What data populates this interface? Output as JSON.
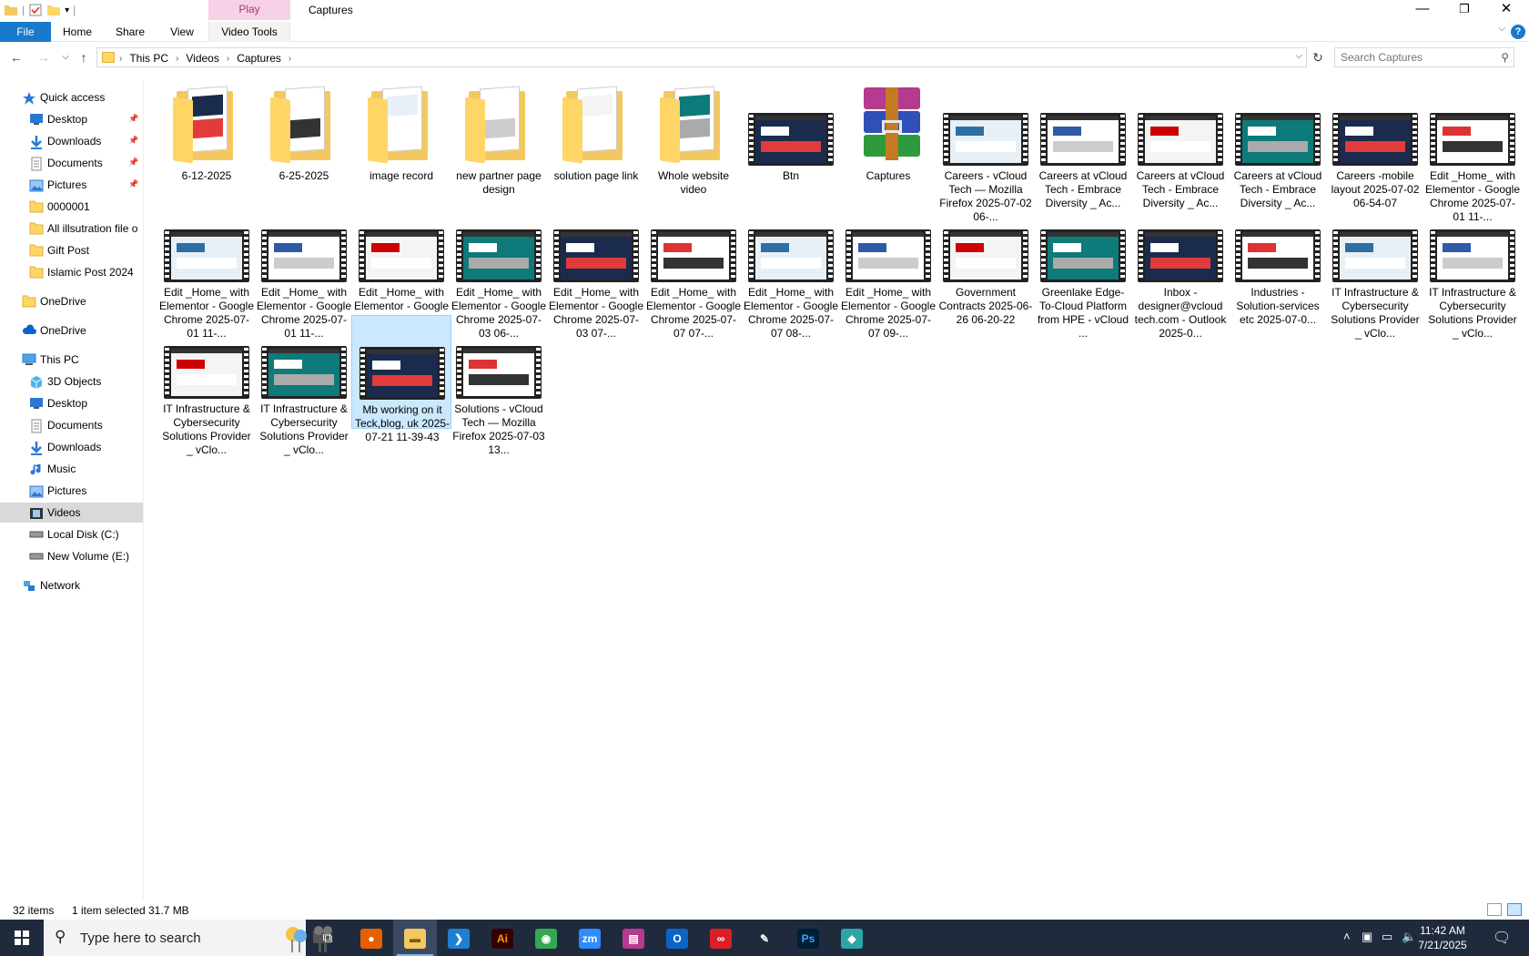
{
  "window": {
    "title": "Captures",
    "play_tab": "Play",
    "minimize": "—",
    "restore": "❐",
    "close": "✕"
  },
  "ribbon": {
    "file": "File",
    "tabs": [
      "Home",
      "Share",
      "View",
      "Video Tools"
    ]
  },
  "address": {
    "breadcrumbs": [
      "This PC",
      "Videos",
      "Captures"
    ]
  },
  "search": {
    "placeholder": "Search Captures"
  },
  "nav": {
    "quick_access": "Quick access",
    "quick_items": [
      "Desktop",
      "Downloads",
      "Documents",
      "Pictures",
      "0000001",
      "All illsutration file o",
      "Gift Post",
      "Islamic Post 2024"
    ],
    "onedrive_1": "OneDrive",
    "onedrive_2": "OneDrive",
    "this_pc": "This PC",
    "pc_items": [
      "3D Objects",
      "Desktop",
      "Documents",
      "Downloads",
      "Music",
      "Pictures",
      "Videos",
      "Local Disk (C:)",
      "New Volume (E:)"
    ],
    "network": "Network"
  },
  "files": [
    {
      "name": "6-12-2025",
      "kind": "folder"
    },
    {
      "name": "6-25-2025",
      "kind": "folder"
    },
    {
      "name": "image record",
      "kind": "folder"
    },
    {
      "name": "new partner page design",
      "kind": "folder"
    },
    {
      "name": "solution page link",
      "kind": "folder"
    },
    {
      "name": "Whole website video",
      "kind": "folder"
    },
    {
      "name": "Btn",
      "kind": "video"
    },
    {
      "name": "Captures",
      "kind": "archive"
    },
    {
      "name": "Careers - vCloud Tech — Mozilla Firefox 2025-07-02 06-...",
      "kind": "video"
    },
    {
      "name": "Careers at vCloud Tech - Embrace Diversity _ Ac...",
      "kind": "video"
    },
    {
      "name": "Careers at vCloud Tech - Embrace Diversity _ Ac...",
      "kind": "video"
    },
    {
      "name": "Careers at vCloud Tech - Embrace Diversity _ Ac...",
      "kind": "video"
    },
    {
      "name": "Careers -mobile layout 2025-07-02 06-54-07",
      "kind": "video"
    },
    {
      "name": "Edit _Home_ with Elementor - Google Chrome 2025-07-01 11-...",
      "kind": "video"
    },
    {
      "name": "Edit _Home_ with Elementor - Google Chrome 2025-07-01 11-...",
      "kind": "video"
    },
    {
      "name": "Edit _Home_ with Elementor - Google Chrome 2025-07-01 11-...",
      "kind": "video"
    },
    {
      "name": "Edit _Home_ with Elementor - Google Chrome 2025-07-01 12-...",
      "kind": "video"
    },
    {
      "name": "Edit _Home_ with Elementor - Google Chrome 2025-07-03 06-...",
      "kind": "video"
    },
    {
      "name": "Edit _Home_ with Elementor - Google Chrome 2025-07-03 07-...",
      "kind": "video"
    },
    {
      "name": "Edit _Home_ with Elementor - Google Chrome 2025-07-07 07-...",
      "kind": "video"
    },
    {
      "name": "Edit _Home_ with Elementor - Google Chrome 2025-07-07 08-...",
      "kind": "video"
    },
    {
      "name": "Edit _Home_ with Elementor - Google Chrome 2025-07-07 09-...",
      "kind": "video"
    },
    {
      "name": "Government Contracts 2025-06-26 06-20-22",
      "kind": "video"
    },
    {
      "name": "Greenlake Edge-To-Cloud Platform from HPE - vCloud ...",
      "kind": "video"
    },
    {
      "name": "Inbox - designer@vcloud tech.com - Outlook 2025-0...",
      "kind": "video"
    },
    {
      "name": "Industries -Solution-services etc 2025-07-0...",
      "kind": "video"
    },
    {
      "name": "IT Infrastructure & Cybersecurity Solutions Provider _ vClo...",
      "kind": "video"
    },
    {
      "name": "IT Infrastructure & Cybersecurity Solutions Provider _ vClo...",
      "kind": "video"
    },
    {
      "name": "IT Infrastructure & Cybersecurity Solutions Provider _ vClo...",
      "kind": "video"
    },
    {
      "name": "IT Infrastructure & Cybersecurity Solutions Provider _ vClo...",
      "kind": "video"
    },
    {
      "name": "Mb working on it Teck,blog, uk 2025-07-21 11-39-43",
      "kind": "video",
      "selected": true
    },
    {
      "name": "Solutions - vCloud Tech — Mozilla Firefox 2025-07-03 13...",
      "kind": "video"
    }
  ],
  "status": {
    "count": "32 items",
    "selection": "1 item selected",
    "size": "31.7 MB"
  },
  "taskbar": {
    "search_text": "Type here to search",
    "apps": [
      "firefox",
      "file-explorer",
      "vscode",
      "illustrator",
      "chrome",
      "zoom",
      "winrar",
      "outlook",
      "creative-cloud",
      "pen-tool",
      "photoshop",
      "app"
    ],
    "time": "11:42 AM",
    "date": "7/21/2025"
  },
  "colors": {
    "accent": "#1979ca",
    "selection": "#cce8ff",
    "taskbar": "#1f2b3d"
  }
}
